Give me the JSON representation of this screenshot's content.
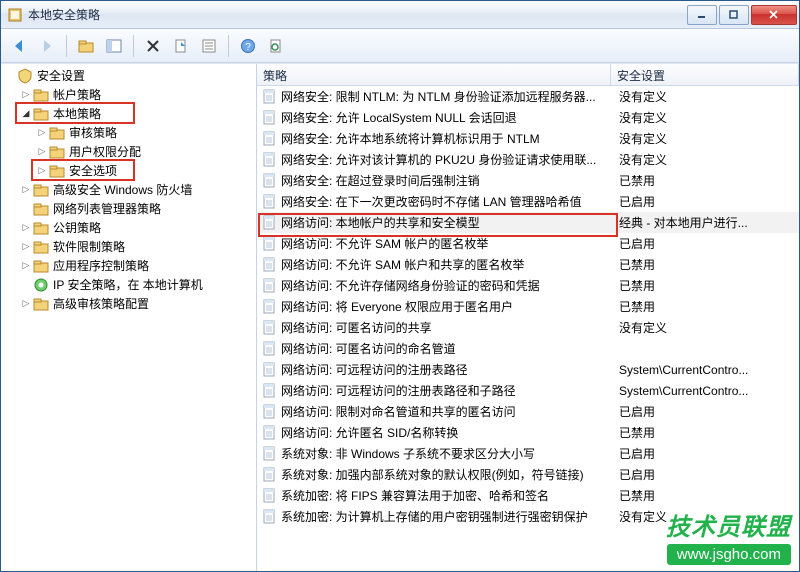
{
  "window": {
    "title": "本地安全策略"
  },
  "toolbar": {
    "back": "后退",
    "forward": "前进"
  },
  "tree": {
    "root": "安全设置",
    "items": [
      {
        "label": "帐户策略",
        "expanded": false,
        "level": 1,
        "type": "folder"
      },
      {
        "label": "本地策略",
        "expanded": true,
        "level": 1,
        "type": "folder",
        "highlight": true
      },
      {
        "label": "审核策略",
        "expanded": false,
        "level": 2,
        "type": "folder"
      },
      {
        "label": "用户权限分配",
        "expanded": false,
        "level": 2,
        "type": "folder"
      },
      {
        "label": "安全选项",
        "expanded": false,
        "level": 2,
        "type": "folder",
        "highlight": true
      },
      {
        "label": "高级安全 Windows 防火墙",
        "expanded": false,
        "level": 1,
        "type": "folder"
      },
      {
        "label": "网络列表管理器策略",
        "expanded": null,
        "level": 1,
        "type": "folder"
      },
      {
        "label": "公钥策略",
        "expanded": false,
        "level": 1,
        "type": "folder"
      },
      {
        "label": "软件限制策略",
        "expanded": false,
        "level": 1,
        "type": "folder"
      },
      {
        "label": "应用程序控制策略",
        "expanded": false,
        "level": 1,
        "type": "folder"
      },
      {
        "label": "IP 安全策略，在 本地计算机",
        "expanded": null,
        "level": 1,
        "type": "ipsec"
      },
      {
        "label": "高级审核策略配置",
        "expanded": false,
        "level": 1,
        "type": "folder"
      }
    ]
  },
  "list": {
    "headers": {
      "policy": "策略",
      "setting": "安全设置"
    },
    "rows": [
      {
        "policy": "网络安全: 限制 NTLM: 为 NTLM 身份验证添加远程服务器...",
        "setting": "没有定义"
      },
      {
        "policy": "网络安全: 允许 LocalSystem NULL 会话回退",
        "setting": "没有定义"
      },
      {
        "policy": "网络安全: 允许本地系统将计算机标识用于 NTLM",
        "setting": "没有定义"
      },
      {
        "policy": "网络安全: 允许对该计算机的 PKU2U 身份验证请求使用联...",
        "setting": "没有定义"
      },
      {
        "policy": "网络安全: 在超过登录时间后强制注销",
        "setting": "已禁用"
      },
      {
        "policy": "网络安全: 在下一次更改密码时不存储 LAN 管理器哈希值",
        "setting": "已启用"
      },
      {
        "policy": "网络访问: 本地帐户的共享和安全模型",
        "setting": "经典 - 对本地用户进行...",
        "selected": true
      },
      {
        "policy": "网络访问: 不允许 SAM 帐户的匿名枚举",
        "setting": "已启用"
      },
      {
        "policy": "网络访问: 不允许 SAM 帐户和共享的匿名枚举",
        "setting": "已禁用"
      },
      {
        "policy": "网络访问: 不允许存储网络身份验证的密码和凭据",
        "setting": "已禁用"
      },
      {
        "policy": "网络访问: 将 Everyone 权限应用于匿名用户",
        "setting": "已禁用"
      },
      {
        "policy": "网络访问: 可匿名访问的共享",
        "setting": "没有定义"
      },
      {
        "policy": "网络访问: 可匿名访问的命名管道",
        "setting": ""
      },
      {
        "policy": "网络访问: 可远程访问的注册表路径",
        "setting": "System\\CurrentContro..."
      },
      {
        "policy": "网络访问: 可远程访问的注册表路径和子路径",
        "setting": "System\\CurrentContro..."
      },
      {
        "policy": "网络访问: 限制对命名管道和共享的匿名访问",
        "setting": "已启用"
      },
      {
        "policy": "网络访问: 允许匿名 SID/名称转换",
        "setting": "已禁用"
      },
      {
        "policy": "系统对象: 非 Windows 子系统不要求区分大小写",
        "setting": "已启用"
      },
      {
        "policy": "系统对象: 加强内部系统对象的默认权限(例如，符号链接)",
        "setting": "已启用"
      },
      {
        "policy": "系统加密: 将 FIPS 兼容算法用于加密、哈希和签名",
        "setting": "已禁用"
      },
      {
        "policy": "系统加密: 为计算机上存储的用户密钥强制进行强密钥保护",
        "setting": "没有定义"
      }
    ]
  },
  "watermark": {
    "line1": "技术员联盟",
    "line2": "www.jsgho.com"
  }
}
